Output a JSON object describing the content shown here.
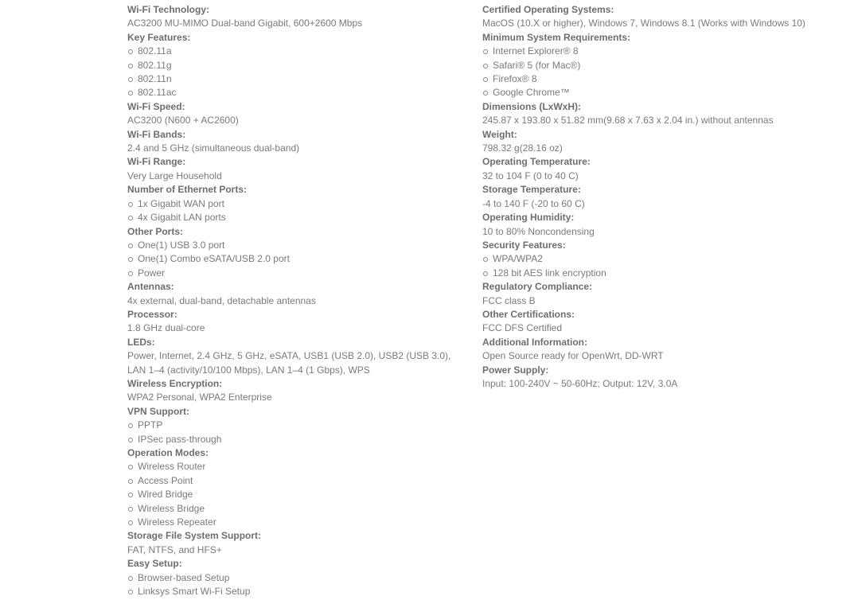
{
  "left": [
    {
      "heading": "Wi-Fi Technology:",
      "value": "AC3200 MU-MIMO Dual-band Gigabit, 600+2600 Mbps"
    },
    {
      "heading": "Key Features:",
      "items": [
        "802.11a",
        "802.11g",
        "802.11n",
        "802.11ac"
      ]
    },
    {
      "heading": "Wi-Fi Speed:",
      "value": "AC3200 (N600 + AC2600)"
    },
    {
      "heading": "Wi-Fi Bands:",
      "value": "2.4 and 5 GHz (simultaneous dual-band)"
    },
    {
      "heading": "Wi-Fi Range:",
      "value": "Very Large Household"
    },
    {
      "heading": "Number of Ethernet Ports:",
      "items": [
        "1x Gigabit WAN port",
        "4x Gigabit LAN ports"
      ]
    },
    {
      "heading": "Other Ports:",
      "items": [
        "One(1) USB 3.0 port",
        "One(1) Combo eSATA/USB 2.0 port",
        "Power"
      ]
    },
    {
      "heading": "Antennas:",
      "value": "4x external, dual-band, detachable antennas"
    },
    {
      "heading": "Processor:",
      "value": "1.8 GHz dual-core"
    },
    {
      "heading": "LEDs:",
      "value": "Power, Internet, 2.4 GHz, 5 GHz, eSATA, USB1 (USB 2.0), USB2 (USB 3.0), LAN 1–4 (activity/10/100 Mbps), LAN 1–4 (1 Gbps), WPS"
    },
    {
      "heading": "Wireless Encryption:",
      "value": "WPA2 Personal, WPA2 Enterprise"
    },
    {
      "heading": "VPN Support:",
      "items": [
        "PPTP",
        "IPSec pass-through"
      ]
    },
    {
      "heading": "Operation Modes:",
      "items": [
        "Wireless Router",
        "Access Point",
        "Wired Bridge",
        "Wireless Bridge",
        "Wireless Repeater"
      ]
    },
    {
      "heading": "Storage File System Support:",
      "value": "FAT, NTFS, and HFS+"
    },
    {
      "heading": "Easy Setup:",
      "items": [
        "Browser-based Setup",
        "Linksys Smart Wi-Fi Setup"
      ]
    }
  ],
  "right": [
    {
      "heading": "Certified Operating Systems:",
      "value": "MacOS (10.X or higher), Windows 7, Windows 8.1 (Works with Windows 10)"
    },
    {
      "heading": "Minimum System Requirements:",
      "items": [
        "Internet Explorer® 8",
        "Safari® 5 (for Mac®)",
        "Firefox® 8",
        "Google Chrome™"
      ]
    },
    {
      "heading": "Dimensions (LxWxH):",
      "value": "245.87 x 193.80 x 51.82 mm(9.68 x 7.63 x 2.04 in.) without antennas"
    },
    {
      "heading": "Weight:",
      "value": "798.32 g(28.16 oz)"
    },
    {
      "heading": "Operating Temperature:",
      "value": "32 to 104 F (0 to 40 C)"
    },
    {
      "heading": "Storage Temperature:",
      "value": "-4 to 140 F (-20 to 60 C)"
    },
    {
      "heading": "Operating Humidity:",
      "value": "10 to 80% Noncondensing"
    },
    {
      "heading": "Security Features:",
      "items": [
        "WPA/WPA2",
        "128 bit AES link encryption"
      ]
    },
    {
      "heading": "Regulatory Compliance:",
      "value": "FCC class B"
    },
    {
      "heading": "Other Certifications:",
      "value": "FCC DFS Certified"
    },
    {
      "heading": "Additional Information:",
      "value": "Open Source ready for OpenWrt, DD-WRT"
    },
    {
      "heading": "Power Supply:",
      "value": "Input: 100-240V ~ 50-60Hz; Output: 12V, 3.0A"
    }
  ]
}
